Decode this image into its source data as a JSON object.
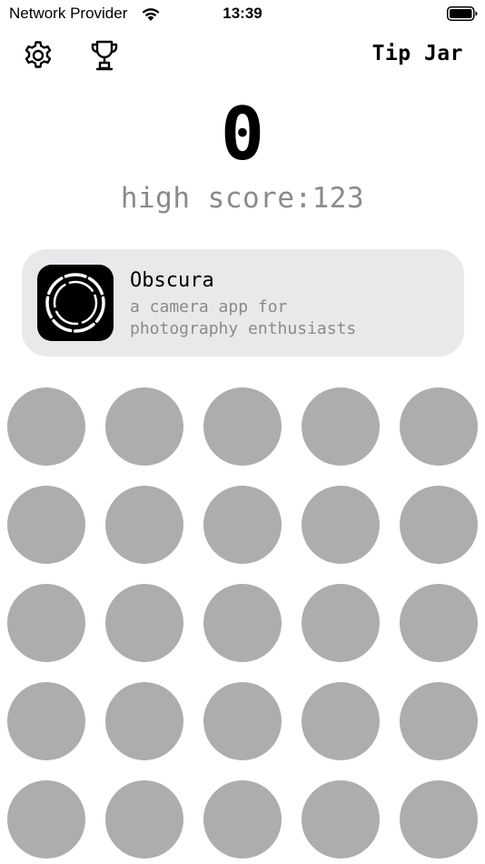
{
  "status_bar": {
    "carrier": "Network Provider",
    "time": "13:39",
    "wifi_icon": "wifi-icon",
    "battery_icon": "battery-full-icon"
  },
  "toolbar": {
    "settings_icon": "gear-icon",
    "leaderboard_icon": "trophy-icon",
    "tip_jar_label": "Tip Jar"
  },
  "game": {
    "score": "0",
    "high_score_text": "high score:123",
    "grid_rows": 5,
    "grid_cols": 5,
    "dot_color": "#adadad"
  },
  "promo": {
    "icon": "obscura-app-icon",
    "title": "Obscura",
    "description_lines": [
      "a camera app for",
      "photography enthusiasts"
    ]
  },
  "colors": {
    "background": "#ffffff",
    "card_background": "#e9e9eb",
    "secondary_text": "#8a8a8e",
    "primary_text": "#000000"
  }
}
